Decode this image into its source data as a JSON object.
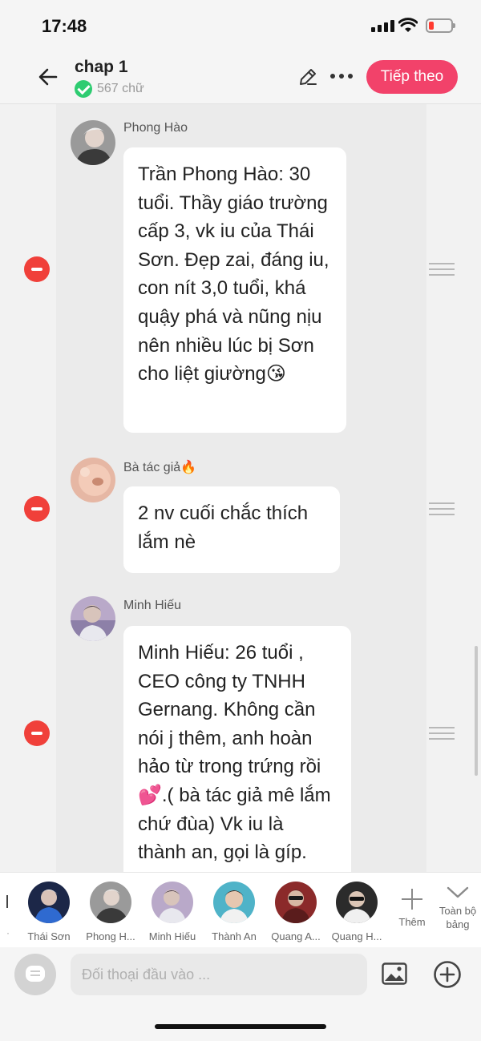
{
  "status_bar": {
    "time": "17:48"
  },
  "header": {
    "title": "chap 1",
    "word_count": "567 chữ",
    "next_label": "Tiếp theo"
  },
  "messages": [
    {
      "sender": "Phong Hào",
      "text": "Trần Phong Hào: 30 tuổi. Thầy giáo trường cấp 3, vk iu của Thái Sơn. Đẹp zai, đáng iu, con nít 3,0 tuổi, khá quậy phá và nũng nịu nên nhiều lúc bị Sơn cho liệt giường😘"
    },
    {
      "sender": "Bà tác giả🔥",
      "text": "2 nv cuối chắc thích lắm nè"
    },
    {
      "sender": "Minh Hiếu",
      "text": "Minh Hiếu: 26 tuổi , CEO công ty TNHH Gernang. Không cần nói j thêm, anh hoàn hảo từ trong trứng rồi 💕.( bà tác giả mê lắm chứ đùa) Vk iu là thành an, gọi là gíp."
    }
  ],
  "characters": [
    {
      "name": "Thái Sơn"
    },
    {
      "name": "Phong H..."
    },
    {
      "name": "Minh Hiếu"
    },
    {
      "name": "Thành An"
    },
    {
      "name": "Quang A..."
    },
    {
      "name": "Quang H..."
    }
  ],
  "char_bar": {
    "add_label": "Thêm",
    "expand_label": "Toàn bộ bảng"
  },
  "input": {
    "placeholder": "Đối thoại đầu vào ..."
  },
  "colors": {
    "accent": "#f2426a",
    "remove": "#f0403a",
    "verified": "#2ecc71"
  },
  "icons": [
    "back-arrow-icon",
    "check-icon",
    "pencil-icon",
    "more-dots-icon",
    "remove-icon",
    "drag-handle-icon",
    "plus-icon",
    "chevron-down-icon",
    "chat-icon",
    "image-icon",
    "add-circle-icon"
  ]
}
